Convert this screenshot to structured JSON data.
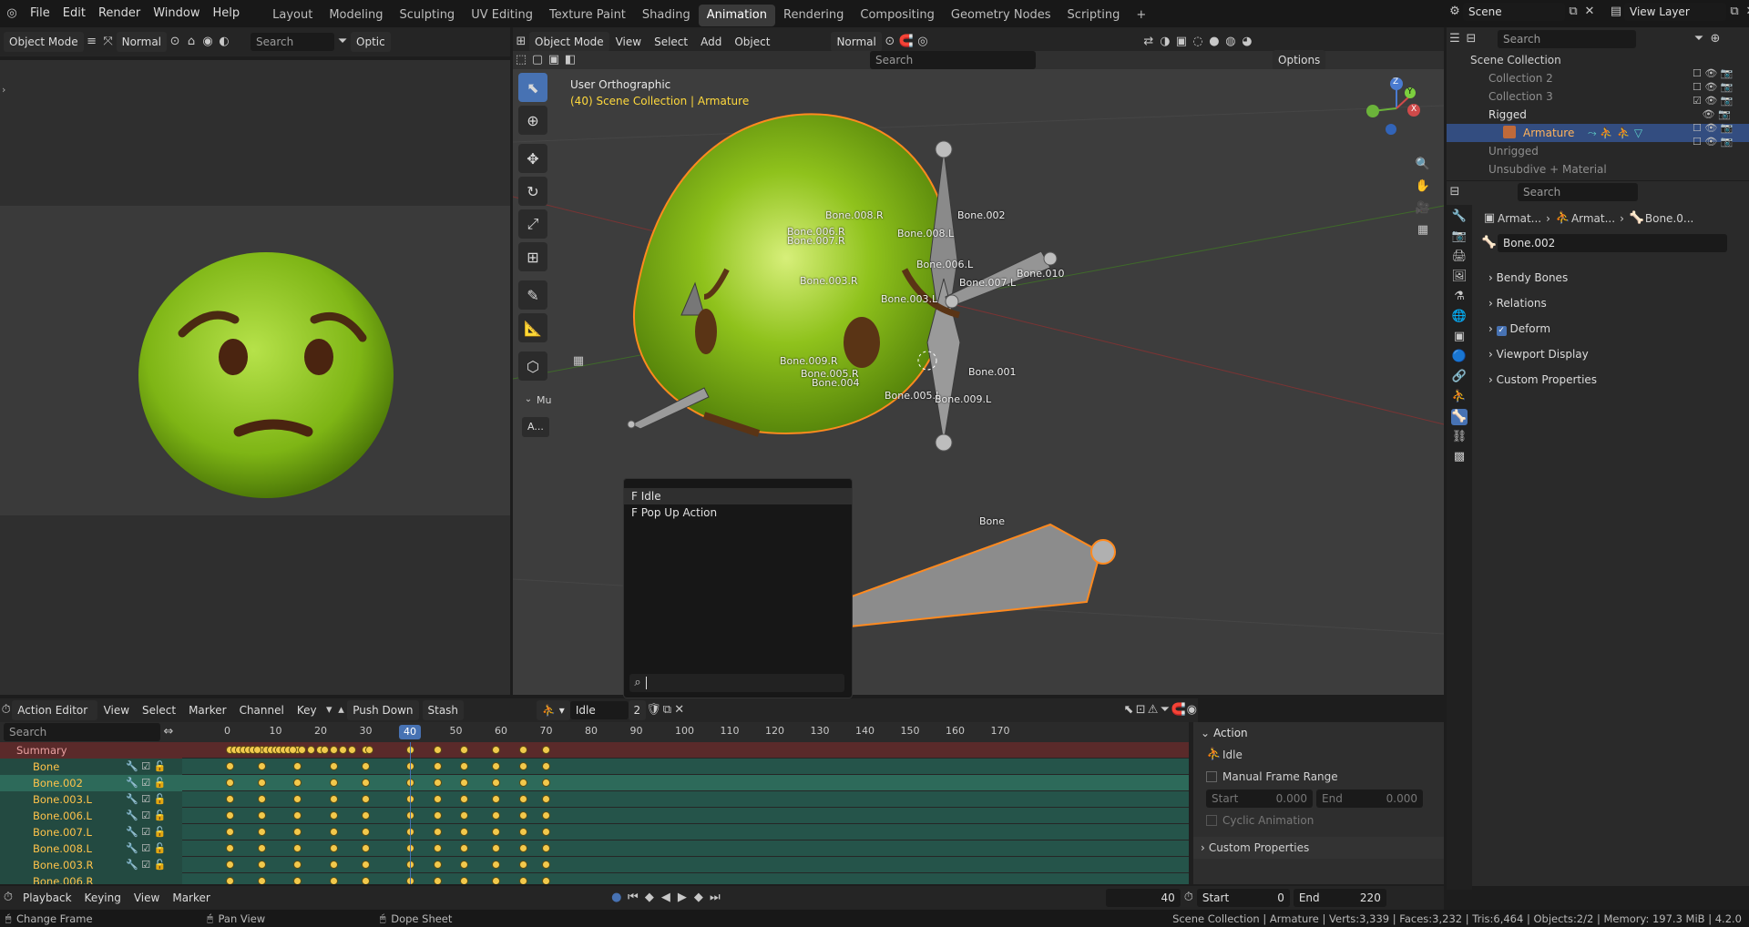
{
  "topbar": {
    "menus": [
      "File",
      "Edit",
      "Render",
      "Window",
      "Help"
    ],
    "workspaces": [
      "Layout",
      "Modeling",
      "Sculpting",
      "UV Editing",
      "Texture Paint",
      "Shading",
      "Animation",
      "Rendering",
      "Compositing",
      "Geometry Nodes",
      "Scripting"
    ],
    "active_workspace": "Animation",
    "add_tab": "+",
    "scene": "Scene",
    "view_layer": "View Layer"
  },
  "left_header": {
    "mode": "Object Mode",
    "shading": "Normal",
    "search_placeholder": "Search",
    "options": "Optic"
  },
  "viewport_header": {
    "mode": "Object Mode",
    "menus": [
      "View",
      "Select",
      "Add",
      "Object"
    ],
    "orientation": "Normal",
    "search_placeholder": "Search",
    "options": "Options"
  },
  "viewport": {
    "view_name": "User Orthographic",
    "collection_info": "(40) Scene Collection | Armature",
    "side_panel": {
      "label": "Mu",
      "button": "A..."
    },
    "bone_labels": [
      "Bone.008.R",
      "Bone.006.R",
      "Bone.007.R",
      "Bone.002",
      "Bone.008.L",
      "Bone.006.L",
      "Bone.007.L",
      "Bone.010",
      "Bone.003.R",
      "Bone.003.L",
      "Bone.001",
      "Bone.009.R",
      "Bone.005.R",
      "Bone.004",
      "Bone.005.L",
      "Bone.009.L",
      "Bone"
    ],
    "gizmo_axes": [
      "Z",
      "Y",
      "X"
    ]
  },
  "outliner": {
    "search_placeholder": "Search",
    "root": "Scene Collection",
    "items": [
      {
        "label": "Collection 2",
        "active": false
      },
      {
        "label": "Collection 3",
        "active": false
      },
      {
        "label": "Rigged",
        "active": false
      },
      {
        "label": "Armature",
        "active": true
      },
      {
        "label": "Unrigged",
        "active": false
      },
      {
        "label": "Unsubdive + Material",
        "active": false
      }
    ]
  },
  "properties": {
    "search_placeholder": "Search",
    "breadcrumb": [
      "Armat...",
      "Armat...",
      "Bone.0..."
    ],
    "bone_name": "Bone.002",
    "panels": [
      "Bendy Bones",
      "Relations",
      "Deform",
      "Viewport Display",
      "Custom Properties"
    ],
    "deform_checked": true
  },
  "dopesheet": {
    "editor_type": "Action Editor",
    "menus": [
      "View",
      "Select",
      "Marker",
      "Channel",
      "Key"
    ],
    "push_down": "Push Down",
    "stash": "Stash",
    "action_name": "Idle",
    "action_users": "2",
    "search_placeholder": "Search",
    "frame_ticks": [
      "0",
      "10",
      "20",
      "30",
      "40",
      "50",
      "60",
      "70",
      "80",
      "90",
      "100",
      "110",
      "120",
      "130",
      "140",
      "150",
      "160",
      "170"
    ],
    "current_frame_label": "40",
    "channels": [
      "Summary",
      "Bone",
      "Bone.002",
      "Bone.003.L",
      "Bone.006.L",
      "Bone.007.L",
      "Bone.008.L",
      "Bone.003.R",
      "Bone.006.R"
    ],
    "selected_channel": "Bone.002",
    "keyframes": [
      0,
      7,
      15,
      23,
      30,
      40,
      46,
      52,
      59,
      65,
      70
    ],
    "summary_extra_keys": [
      1,
      2,
      3,
      4,
      5,
      6,
      8,
      9,
      10,
      11,
      12,
      13,
      14,
      16,
      18,
      20,
      21,
      25,
      27,
      31
    ],
    "sidebar": {
      "section": "Action",
      "action_name": "Idle",
      "manual_frame_range": "Manual Frame Range",
      "start_label": "Start",
      "start_value": "0.000",
      "end_label": "End",
      "end_value": "0.000",
      "cyclic": "Cyclic Animation",
      "custom_props": "Custom Properties"
    }
  },
  "action_dropdown": {
    "items": [
      "F Idle",
      "F Pop Up Action"
    ],
    "highlighted": "F Idle"
  },
  "timeline": {
    "menus": [
      "Playback",
      "Keying",
      "View",
      "Marker"
    ],
    "current_frame": "40",
    "start_label": "Start",
    "start_value": "0",
    "end_label": "End",
    "end_value": "220"
  },
  "statusbar": {
    "left": [
      "Change Frame",
      "Pan View",
      "Dope Sheet"
    ],
    "right": "Scene Collection | Armature | Verts:3,339 | Faces:3,232 | Tris:6,464 | Objects:2/2 | Memory: 197.3 MiB | 4.2.0"
  },
  "colors": {
    "accent": "#4772b3",
    "selected_orange": "#ffa64d",
    "keyframe": "#f2c94c",
    "channel_bg": "#25544a",
    "summary_bg": "#5a2a2a",
    "head_green": "#8fc21c"
  }
}
